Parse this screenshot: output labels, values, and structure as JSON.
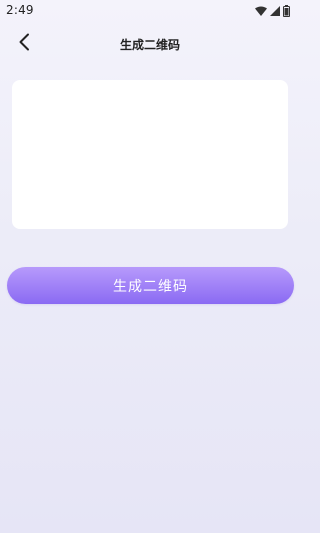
{
  "status_bar": {
    "time": "2:49",
    "icons": [
      "wifi-icon",
      "cell-signal-icon",
      "battery-icon"
    ]
  },
  "header": {
    "back_icon": "chevron-left-icon",
    "title": "生成二维码"
  },
  "input": {
    "value": "",
    "placeholder": ""
  },
  "actions": {
    "generate_label": "生成二维码"
  },
  "colors": {
    "button_top": "#b79afb",
    "button_bottom": "#8a6af3",
    "background": "#eeedf9",
    "card": "#ffffff"
  }
}
